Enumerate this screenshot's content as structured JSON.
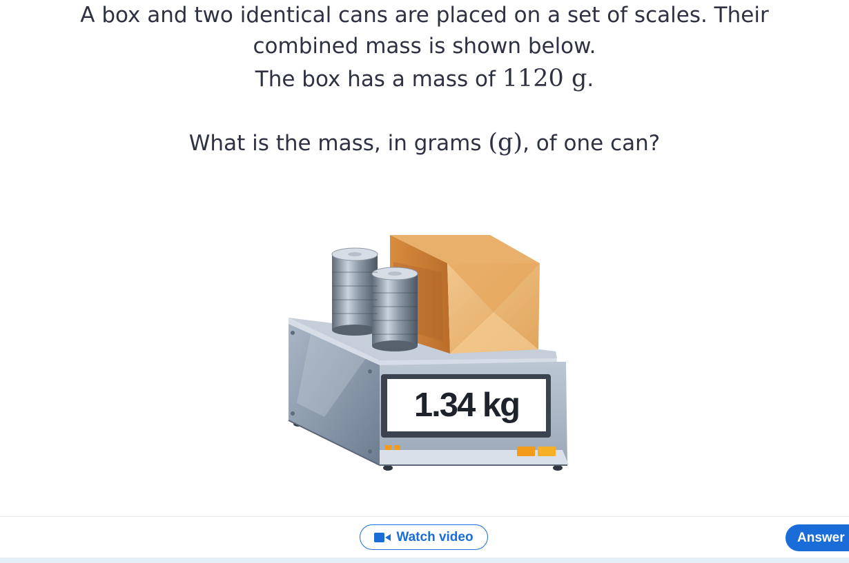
{
  "question": {
    "line1": "A box and two identical cans are placed on a set of scales. Their",
    "line2": "combined mass is shown below.",
    "line3_prefix": "The box has a mass of ",
    "line3_math": "1120 g",
    "line3_suffix": ".",
    "line4_prefix": "What is the mass, in grams ",
    "line4_math": "(g)",
    "line4_suffix": ", of one can?"
  },
  "scale": {
    "display_reading": "1.34 kg"
  },
  "footer": {
    "watch_video_label": "Watch video",
    "watch_video_icon": "video-camera-icon",
    "answer_label": "Answer"
  },
  "colors": {
    "text": "#2e3142",
    "accent_blue": "#1a6dd8",
    "footer_strip": "#e6eef8"
  }
}
